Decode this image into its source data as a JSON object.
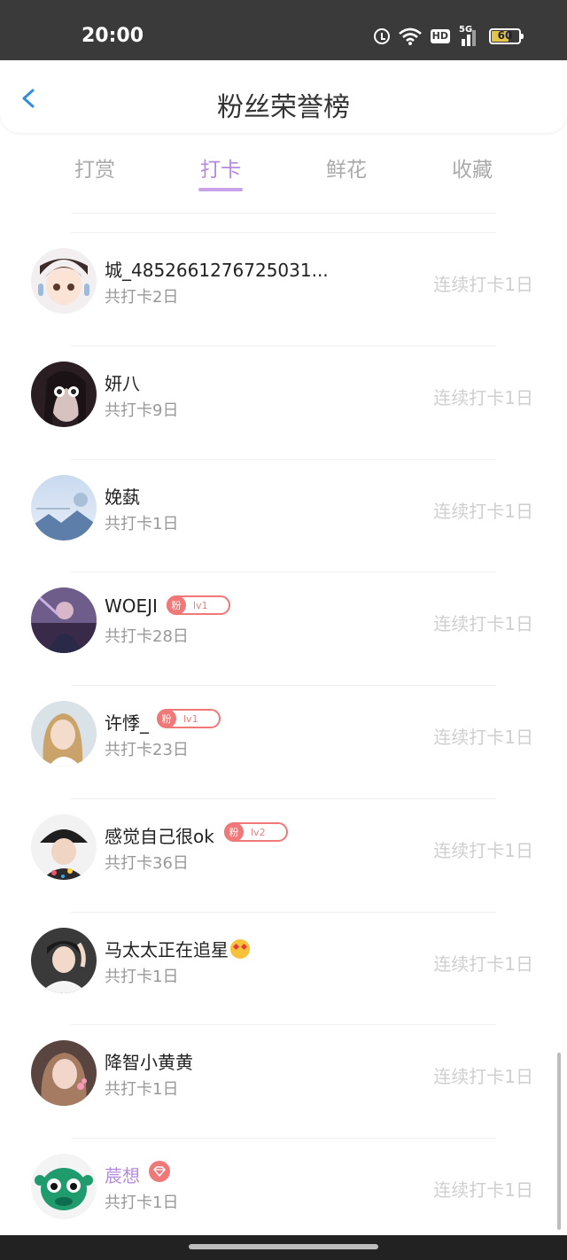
{
  "status": {
    "time": "20:00",
    "battery": "60",
    "network": "5G",
    "hd": "HD"
  },
  "header": {
    "title": "粉丝荣誉榜"
  },
  "tabs": [
    {
      "label": "打赏",
      "active": false
    },
    {
      "label": "打卡",
      "active": true
    },
    {
      "label": "鲜花",
      "active": false
    },
    {
      "label": "收藏",
      "active": false
    }
  ],
  "list": [
    {
      "name": "城_4852661276725031...",
      "total": "共打卡2日",
      "streak": "连续打卡1日",
      "avatar": "avatar-anime"
    },
    {
      "name": "妍八",
      "total": "共打卡9日",
      "streak": "连续打卡1日",
      "avatar": "avatar-dark"
    },
    {
      "name": "娩蓺",
      "total": "共打卡1日",
      "streak": "连续打卡1日",
      "avatar": "avatar-sky"
    },
    {
      "name": "WOEJI",
      "total": "共打卡28日",
      "streak": "连续打卡1日",
      "avatar": "avatar-purple",
      "badge": {
        "fan": "粉",
        "level": "lv1"
      }
    },
    {
      "name": "许悸_",
      "total": "共打卡23日",
      "streak": "连续打卡1日",
      "avatar": "avatar-girl",
      "badge": {
        "fan": "粉",
        "level": "lv1"
      }
    },
    {
      "name": "感觉自己很ok",
      "total": "共打卡36日",
      "streak": "连续打卡1日",
      "avatar": "avatar-hat",
      "badge": {
        "fan": "粉",
        "level": "lv2"
      }
    },
    {
      "name": "马太太正在追星",
      "total": "共打卡1日",
      "streak": "连续打卡1日",
      "avatar": "avatar-boy",
      "emoji": "star-struck-emoji"
    },
    {
      "name": "降智小黄黄",
      "total": "共打卡1日",
      "streak": "连续打卡1日",
      "avatar": "avatar-brown"
    },
    {
      "name": "莀想",
      "total": "共打卡1日",
      "streak": "连续打卡1日",
      "avatar": "avatar-green",
      "name_color": "#b48ae0",
      "vip": "diamond-icon"
    }
  ],
  "colors": {
    "accent": "#b48ae0",
    "badge": "#f17878",
    "status_bar": "#3a3a3a"
  }
}
